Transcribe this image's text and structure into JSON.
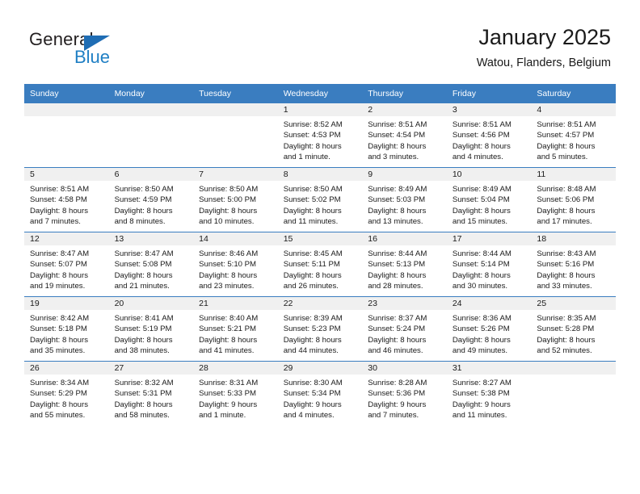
{
  "brand": {
    "name_top": "General",
    "name_bottom": "Blue",
    "color_dark": "#231f20",
    "color_blue": "#1f7fc4"
  },
  "header": {
    "title": "January 2025",
    "subtitle": "Watou, Flanders, Belgium"
  },
  "theme": {
    "header_bg": "#3A7DC0",
    "daynum_bg": "#F0F0F0",
    "text": "#1a1a1a"
  },
  "weekday_headers": [
    "Sunday",
    "Monday",
    "Tuesday",
    "Wednesday",
    "Thursday",
    "Friday",
    "Saturday"
  ],
  "weeks": [
    [
      {
        "day": "",
        "lines": []
      },
      {
        "day": "",
        "lines": []
      },
      {
        "day": "",
        "lines": []
      },
      {
        "day": "1",
        "lines": [
          "Sunrise: 8:52 AM",
          "Sunset: 4:53 PM",
          "Daylight: 8 hours",
          "and 1 minute."
        ]
      },
      {
        "day": "2",
        "lines": [
          "Sunrise: 8:51 AM",
          "Sunset: 4:54 PM",
          "Daylight: 8 hours",
          "and 3 minutes."
        ]
      },
      {
        "day": "3",
        "lines": [
          "Sunrise: 8:51 AM",
          "Sunset: 4:56 PM",
          "Daylight: 8 hours",
          "and 4 minutes."
        ]
      },
      {
        "day": "4",
        "lines": [
          "Sunrise: 8:51 AM",
          "Sunset: 4:57 PM",
          "Daylight: 8 hours",
          "and 5 minutes."
        ]
      }
    ],
    [
      {
        "day": "5",
        "lines": [
          "Sunrise: 8:51 AM",
          "Sunset: 4:58 PM",
          "Daylight: 8 hours",
          "and 7 minutes."
        ]
      },
      {
        "day": "6",
        "lines": [
          "Sunrise: 8:50 AM",
          "Sunset: 4:59 PM",
          "Daylight: 8 hours",
          "and 8 minutes."
        ]
      },
      {
        "day": "7",
        "lines": [
          "Sunrise: 8:50 AM",
          "Sunset: 5:00 PM",
          "Daylight: 8 hours",
          "and 10 minutes."
        ]
      },
      {
        "day": "8",
        "lines": [
          "Sunrise: 8:50 AM",
          "Sunset: 5:02 PM",
          "Daylight: 8 hours",
          "and 11 minutes."
        ]
      },
      {
        "day": "9",
        "lines": [
          "Sunrise: 8:49 AM",
          "Sunset: 5:03 PM",
          "Daylight: 8 hours",
          "and 13 minutes."
        ]
      },
      {
        "day": "10",
        "lines": [
          "Sunrise: 8:49 AM",
          "Sunset: 5:04 PM",
          "Daylight: 8 hours",
          "and 15 minutes."
        ]
      },
      {
        "day": "11",
        "lines": [
          "Sunrise: 8:48 AM",
          "Sunset: 5:06 PM",
          "Daylight: 8 hours",
          "and 17 minutes."
        ]
      }
    ],
    [
      {
        "day": "12",
        "lines": [
          "Sunrise: 8:47 AM",
          "Sunset: 5:07 PM",
          "Daylight: 8 hours",
          "and 19 minutes."
        ]
      },
      {
        "day": "13",
        "lines": [
          "Sunrise: 8:47 AM",
          "Sunset: 5:08 PM",
          "Daylight: 8 hours",
          "and 21 minutes."
        ]
      },
      {
        "day": "14",
        "lines": [
          "Sunrise: 8:46 AM",
          "Sunset: 5:10 PM",
          "Daylight: 8 hours",
          "and 23 minutes."
        ]
      },
      {
        "day": "15",
        "lines": [
          "Sunrise: 8:45 AM",
          "Sunset: 5:11 PM",
          "Daylight: 8 hours",
          "and 26 minutes."
        ]
      },
      {
        "day": "16",
        "lines": [
          "Sunrise: 8:44 AM",
          "Sunset: 5:13 PM",
          "Daylight: 8 hours",
          "and 28 minutes."
        ]
      },
      {
        "day": "17",
        "lines": [
          "Sunrise: 8:44 AM",
          "Sunset: 5:14 PM",
          "Daylight: 8 hours",
          "and 30 minutes."
        ]
      },
      {
        "day": "18",
        "lines": [
          "Sunrise: 8:43 AM",
          "Sunset: 5:16 PM",
          "Daylight: 8 hours",
          "and 33 minutes."
        ]
      }
    ],
    [
      {
        "day": "19",
        "lines": [
          "Sunrise: 8:42 AM",
          "Sunset: 5:18 PM",
          "Daylight: 8 hours",
          "and 35 minutes."
        ]
      },
      {
        "day": "20",
        "lines": [
          "Sunrise: 8:41 AM",
          "Sunset: 5:19 PM",
          "Daylight: 8 hours",
          "and 38 minutes."
        ]
      },
      {
        "day": "21",
        "lines": [
          "Sunrise: 8:40 AM",
          "Sunset: 5:21 PM",
          "Daylight: 8 hours",
          "and 41 minutes."
        ]
      },
      {
        "day": "22",
        "lines": [
          "Sunrise: 8:39 AM",
          "Sunset: 5:23 PM",
          "Daylight: 8 hours",
          "and 44 minutes."
        ]
      },
      {
        "day": "23",
        "lines": [
          "Sunrise: 8:37 AM",
          "Sunset: 5:24 PM",
          "Daylight: 8 hours",
          "and 46 minutes."
        ]
      },
      {
        "day": "24",
        "lines": [
          "Sunrise: 8:36 AM",
          "Sunset: 5:26 PM",
          "Daylight: 8 hours",
          "and 49 minutes."
        ]
      },
      {
        "day": "25",
        "lines": [
          "Sunrise: 8:35 AM",
          "Sunset: 5:28 PM",
          "Daylight: 8 hours",
          "and 52 minutes."
        ]
      }
    ],
    [
      {
        "day": "26",
        "lines": [
          "Sunrise: 8:34 AM",
          "Sunset: 5:29 PM",
          "Daylight: 8 hours",
          "and 55 minutes."
        ]
      },
      {
        "day": "27",
        "lines": [
          "Sunrise: 8:32 AM",
          "Sunset: 5:31 PM",
          "Daylight: 8 hours",
          "and 58 minutes."
        ]
      },
      {
        "day": "28",
        "lines": [
          "Sunrise: 8:31 AM",
          "Sunset: 5:33 PM",
          "Daylight: 9 hours",
          "and 1 minute."
        ]
      },
      {
        "day": "29",
        "lines": [
          "Sunrise: 8:30 AM",
          "Sunset: 5:34 PM",
          "Daylight: 9 hours",
          "and 4 minutes."
        ]
      },
      {
        "day": "30",
        "lines": [
          "Sunrise: 8:28 AM",
          "Sunset: 5:36 PM",
          "Daylight: 9 hours",
          "and 7 minutes."
        ]
      },
      {
        "day": "31",
        "lines": [
          "Sunrise: 8:27 AM",
          "Sunset: 5:38 PM",
          "Daylight: 9 hours",
          "and 11 minutes."
        ]
      },
      {
        "day": "",
        "lines": []
      }
    ]
  ]
}
